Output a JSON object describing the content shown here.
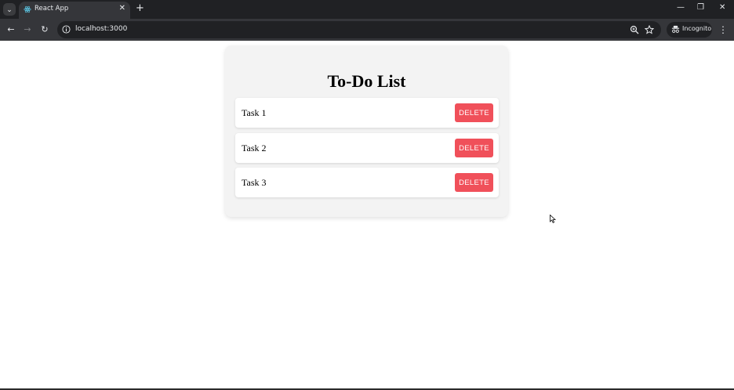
{
  "browser": {
    "tab_title": "React App",
    "url": "localhost:3000",
    "incognito_label": "Incognito",
    "icons": {
      "tab_search": "chevron-down-icon",
      "favicon": "react-logo-icon",
      "tab_close": "close-icon",
      "new_tab": "plus-icon",
      "back": "arrow-left-icon",
      "forward": "arrow-right-icon",
      "reload": "reload-icon",
      "site_info": "info-icon",
      "zoom": "zoom-icon",
      "bookmark": "star-icon",
      "menu": "kebab-icon"
    }
  },
  "app": {
    "title": "To-Do List",
    "tasks": [
      {
        "text": "Task 1",
        "delete_label": "DELETE"
      },
      {
        "text": "Task 2",
        "delete_label": "DELETE"
      },
      {
        "text": "Task 3",
        "delete_label": "DELETE"
      }
    ]
  },
  "colors": {
    "chrome_dark": "#202124",
    "chrome_toolbar": "#35363a",
    "card_bg": "#f3f3f3",
    "delete_button": "#f0505a"
  }
}
